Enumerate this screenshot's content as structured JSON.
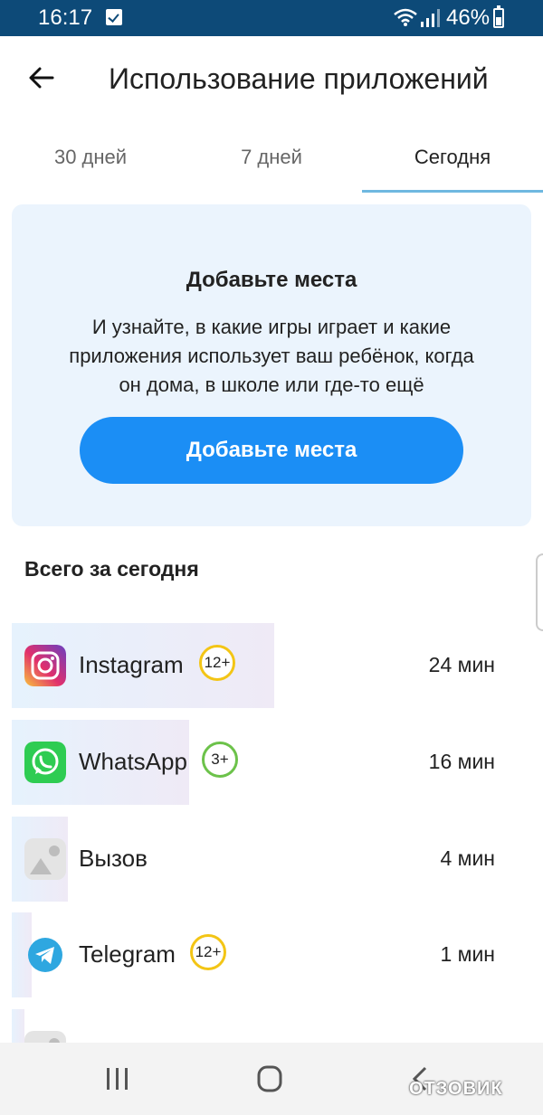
{
  "status_bar": {
    "time": "16:17",
    "battery": "46%"
  },
  "header": {
    "title": "Использование приложений"
  },
  "tabs": [
    {
      "label": "30 дней",
      "active": false
    },
    {
      "label": "7 дней",
      "active": false
    },
    {
      "label": "Сегодня",
      "active": true
    }
  ],
  "promo": {
    "title": "Добавьте места",
    "text": "И узнайте, в какие игры играет и какие приложения использует ваш ребёнок, когда он дома, в школе или где-то ещё",
    "button_label": "Добавьте места"
  },
  "section": {
    "title": "Всего за сегодня"
  },
  "apps": [
    {
      "name": "Instagram",
      "rating": "12+",
      "time": "24 мин",
      "share": 0.5,
      "icon": "instagram-icon"
    },
    {
      "name": "WhatsApp",
      "rating": "3+",
      "time": "16 мин",
      "share": 0.33,
      "icon": "whatsapp-icon"
    },
    {
      "name": "Вызов",
      "rating": "",
      "time": "4 мин",
      "share": 0.1,
      "icon": "image-placeholder-icon"
    },
    {
      "name": "Telegram",
      "rating": "12+",
      "time": "1 мин",
      "share": 0.04,
      "icon": "telegram-icon"
    }
  ],
  "watermark": "ОТЗОВИК",
  "colors": {
    "accent": "#1b8ef5",
    "status_bar": "#0d4a78",
    "promo_bg": "#ebf4fd",
    "badge_yellow": "#f3c515",
    "badge_green": "#6cc24a"
  }
}
